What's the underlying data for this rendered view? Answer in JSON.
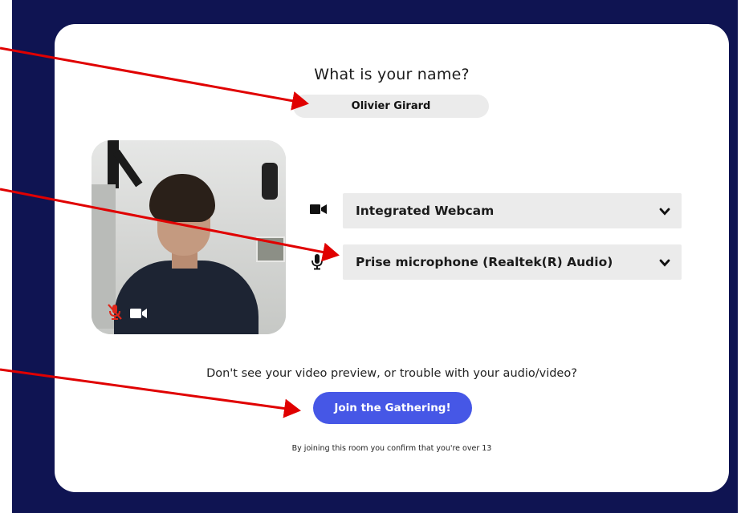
{
  "join_form": {
    "title": "What is your name?",
    "name_value": "Olivier Girard",
    "preview": {
      "mic_state_icon": "microphone-muted-icon",
      "camera_state_icon": "video-camera-icon",
      "mic_muted_color": "#e0271a"
    },
    "devices": {
      "camera": {
        "icon": "video-camera-icon",
        "selected": "Integrated Webcam"
      },
      "microphone": {
        "icon": "microphone-icon",
        "selected": "Prise microphone (Realtek(R) Audio)"
      }
    },
    "help_text": "Don't see your video preview, or trouble with your audio/video?",
    "join_button_label": "Join the Gathering!",
    "footer_text": "By joining this room you confirm that you're over 13"
  },
  "colors": {
    "background": "#0f1452",
    "card": "#ffffff",
    "field_bg": "#ebebeb",
    "button": "#4657e6",
    "annotation_arrow": "#e00000"
  }
}
